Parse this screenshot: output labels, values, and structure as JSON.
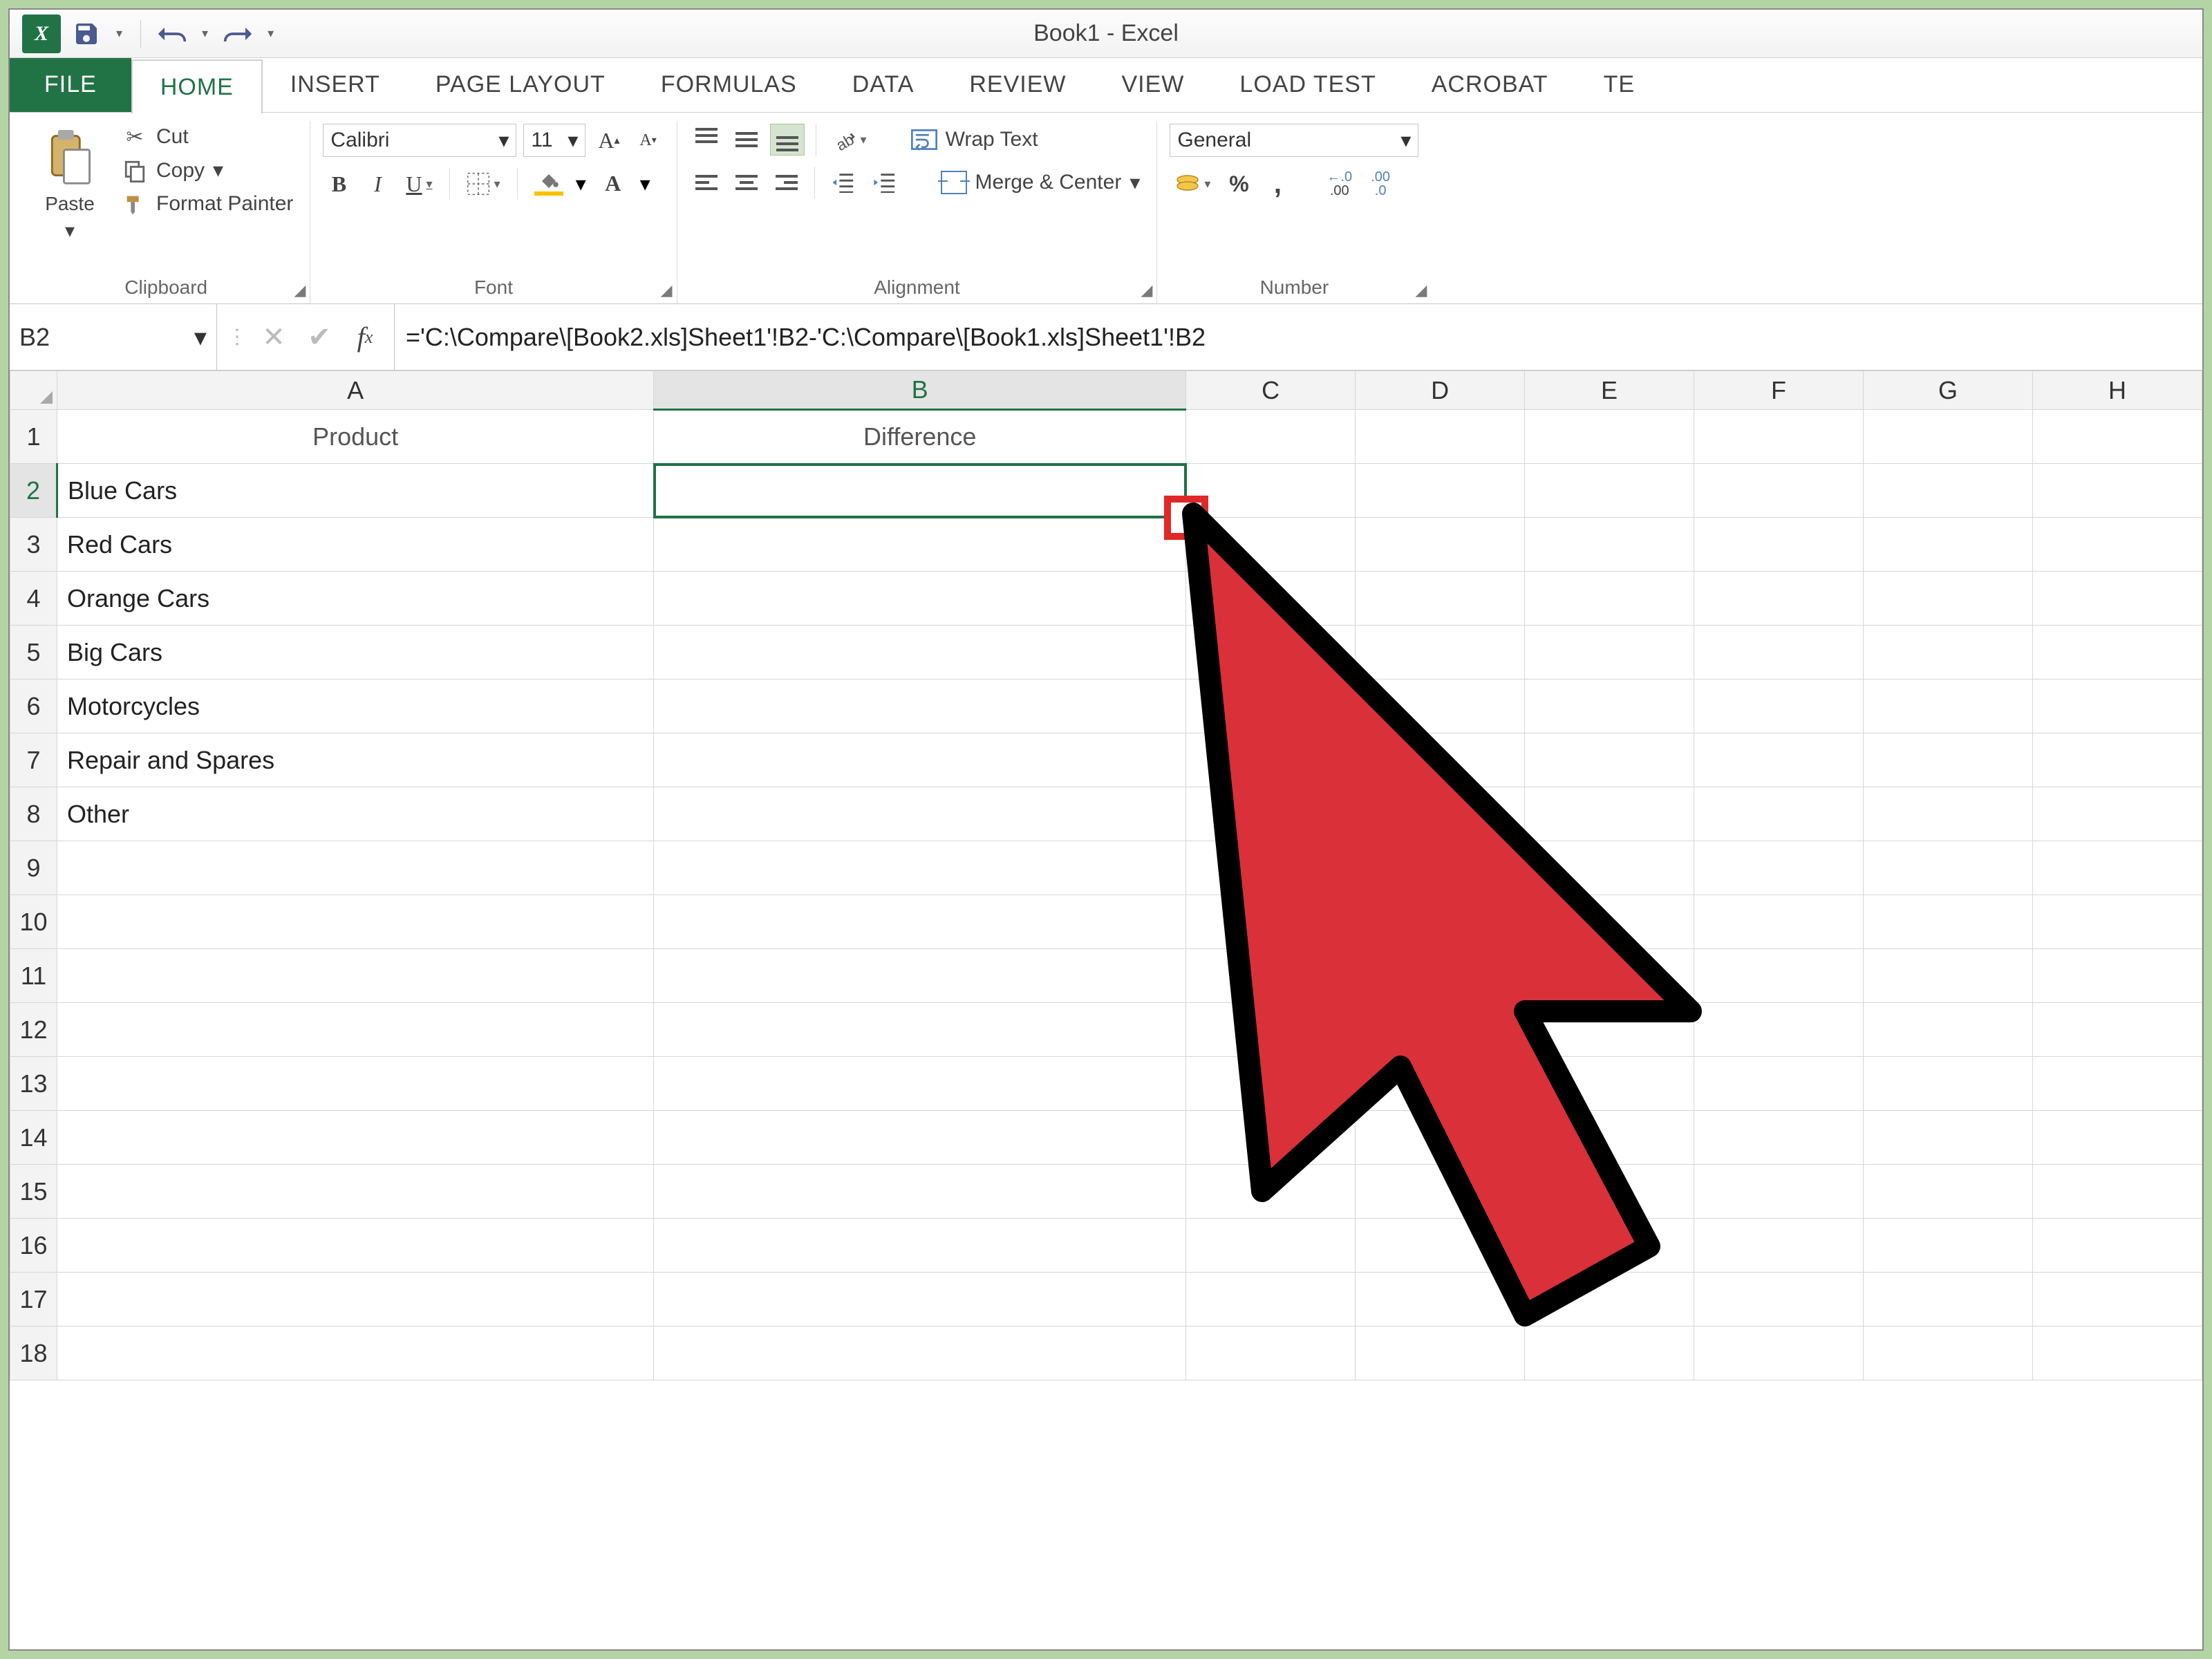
{
  "window": {
    "title": "Book1 - Excel"
  },
  "qat": {
    "save": "save",
    "undo": "undo",
    "redo": "redo"
  },
  "tabs": {
    "file": "FILE",
    "home": "HOME",
    "insert": "INSERT",
    "pagelayout": "PAGE LAYOUT",
    "formulas": "FORMULAS",
    "data": "DATA",
    "review": "REVIEW",
    "view": "VIEW",
    "loadtest": "LOAD TEST",
    "acrobat": "ACROBAT",
    "team": "TE"
  },
  "ribbon": {
    "clipboard": {
      "label": "Clipboard",
      "paste": "Paste",
      "cut": "Cut",
      "copy": "Copy",
      "format_painter": "Format Painter"
    },
    "font": {
      "label": "Font",
      "name": "Calibri",
      "size": "11",
      "bold": "B",
      "italic": "I",
      "underline": "U"
    },
    "alignment": {
      "label": "Alignment",
      "wrap": "Wrap Text",
      "merge": "Merge & Center"
    },
    "number": {
      "label": "Number",
      "format": "General",
      "percent": "%",
      "comma": ","
    }
  },
  "namebox": "B2",
  "formula": "='C:\\Compare\\[Book2.xls]Sheet1'!B2-'C:\\Compare\\[Book1.xls]Sheet1'!B2",
  "columns": [
    "A",
    "B",
    "C",
    "D",
    "E",
    "F",
    "G",
    "H"
  ],
  "rows": [
    "1",
    "2",
    "3",
    "4",
    "5",
    "6",
    "7",
    "8",
    "9",
    "10",
    "11",
    "12",
    "13",
    "14",
    "15",
    "16",
    "17",
    "18"
  ],
  "cells": {
    "A1": "Product",
    "B1": "Difference",
    "A2": "Blue Cars",
    "A3": "Red Cars",
    "A4": "Orange Cars",
    "A5": "Big Cars",
    "A6": "Motorcycles",
    "A7": "Repair and Spares",
    "A8": "Other"
  },
  "selected": {
    "cell": "B2",
    "row": "2",
    "col": "B"
  },
  "decimal_inc": ".00",
  "decimal_dec": ".0"
}
